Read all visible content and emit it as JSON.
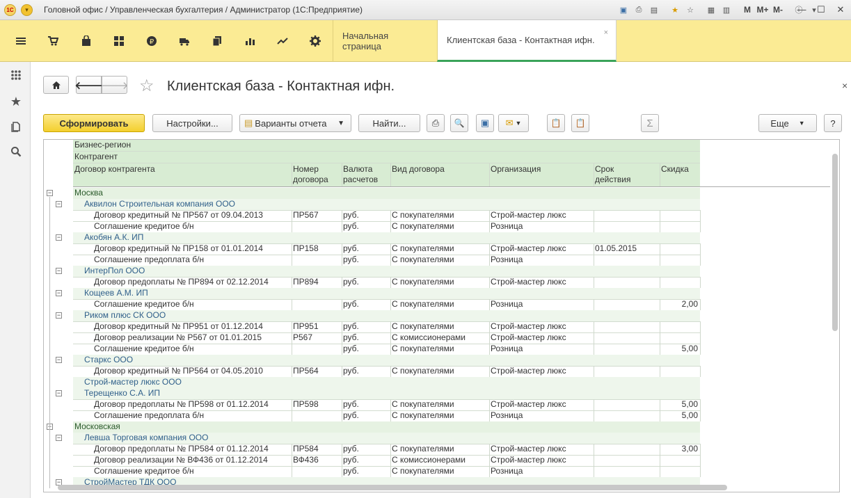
{
  "window": {
    "title": "Головной офис / Управленческая бухгалтерия / Администратор  (1С:Предприятие)",
    "logo": "1С",
    "app_menu_icon": "chevron-down-icon",
    "icons": [
      "save-icon",
      "print-icon",
      "preview-icon",
      "favorite-add-icon",
      "favorite-icon",
      "calculator-icon",
      "calendar-icon"
    ],
    "m_labels": [
      "M",
      "M+",
      "M-"
    ],
    "info_icon": "info-icon"
  },
  "sections": [
    "menu-icon",
    "cart-icon",
    "bag-icon",
    "grid-icon",
    "ruble-icon",
    "truck-icon",
    "documents-icon",
    "bar-chart-icon",
    "trend-icon",
    "gear-icon"
  ],
  "tabs": [
    {
      "label": "Начальная страница"
    },
    {
      "label": "Клиентская база - Контактная ифн.",
      "close": "×"
    }
  ],
  "leftbar": [
    "apps-icon",
    "star-icon",
    "history-icon",
    "search-icon"
  ],
  "page": {
    "title": "Клиентская база - Контактная ифн.",
    "close": "×",
    "star": "☆"
  },
  "buttons": {
    "generate": "Сформировать",
    "settings": "Настройки...",
    "variants": "Варианты отчета",
    "find": "Найти...",
    "more": "Еще",
    "help": "?",
    "sigma": "Σ"
  },
  "report": {
    "header": {
      "level1": "Бизнес-регион",
      "level2": "Контрагент",
      "columns": [
        "Договор контрагента",
        "Номер\nдоговора",
        "Валюта\nрасчетов",
        "Вид договора",
        "Организация",
        "Срок\nдействия",
        "Скидка"
      ]
    },
    "rows": [
      {
        "level": 0,
        "text": "Москва"
      },
      {
        "level": 1,
        "text": "Аквилон Строительная компания ООО"
      },
      {
        "level": 2,
        "cells": [
          "Договор кредитный № ПР567 от 09.04.2013",
          "ПР567",
          "руб.",
          "С покупателями",
          "Строй-мастер люкс",
          "",
          ""
        ]
      },
      {
        "level": 2,
        "cells": [
          "Соглашение кредитое б/н",
          "",
          "руб.",
          "С покупателями",
          "Розница",
          "",
          ""
        ]
      },
      {
        "level": 1,
        "text": "Акобян А.К. ИП"
      },
      {
        "level": 2,
        "cells": [
          "Договор кредитный № ПР158 от 01.01.2014",
          "ПР158",
          "руб.",
          "С покупателями",
          "Строй-мастер люкс",
          "01.05.2015",
          ""
        ]
      },
      {
        "level": 2,
        "cells": [
          "Соглашение предоплата б/н",
          "",
          "руб.",
          "С покупателями",
          "Розница",
          "",
          ""
        ]
      },
      {
        "level": 1,
        "text": "ИнтерПол ООО"
      },
      {
        "level": 2,
        "cells": [
          "Договор предоплаты № ПР894 от 02.12.2014",
          "ПР894",
          "руб.",
          "С покупателями",
          "Строй-мастер люкс",
          "",
          ""
        ]
      },
      {
        "level": 1,
        "text": "Кощеев А.М. ИП"
      },
      {
        "level": 2,
        "cells": [
          "Соглашение кредитое б/н",
          "",
          "руб.",
          "С покупателями",
          "Розница",
          "",
          "2,00"
        ]
      },
      {
        "level": 1,
        "text": "Риком плюс СК ООО"
      },
      {
        "level": 2,
        "cells": [
          "Договор кредитный № ПР951 от 01.12.2014",
          "ПР951",
          "руб.",
          "С покупателями",
          "Строй-мастер люкс",
          "",
          ""
        ]
      },
      {
        "level": 2,
        "cells": [
          "Договор реализации № Р567 от 01.01.2015",
          "Р567",
          "руб.",
          "С комиссионерами",
          "Строй-мастер люкс",
          "",
          ""
        ]
      },
      {
        "level": 2,
        "cells": [
          "Соглашение кредитое б/н",
          "",
          "руб.",
          "С покупателями",
          "Розница",
          "",
          "5,00"
        ]
      },
      {
        "level": 1,
        "text": "Старкс ООО"
      },
      {
        "level": 2,
        "cells": [
          "Договор кредитный № ПР564 от 04.05.2010",
          "ПР564",
          "руб.",
          "С покупателями",
          "Строй-мастер люкс",
          "",
          ""
        ]
      },
      {
        "level": 1,
        "text": "Строй-мастер люкс ООО",
        "noexp": true
      },
      {
        "level": 1,
        "text": "Терещенко С.А. ИП"
      },
      {
        "level": 2,
        "cells": [
          "Договор предоплаты № ПР598 от 01.12.2014",
          "ПР598",
          "руб.",
          "С покупателями",
          "Строй-мастер люкс",
          "",
          "5,00"
        ]
      },
      {
        "level": 2,
        "cells": [
          "Соглашение предоплата б/н",
          "",
          "руб.",
          "С покупателями",
          "Розница",
          "",
          "5,00"
        ]
      },
      {
        "level": 0,
        "text": "Московская"
      },
      {
        "level": 1,
        "text": "Левша Торговая компания ООО"
      },
      {
        "level": 2,
        "cells": [
          "Договор предоплаты № ПР584 от 01.12.2014",
          "ПР584",
          "руб.",
          "С покупателями",
          "Строй-мастер люкс",
          "",
          "3,00"
        ]
      },
      {
        "level": 2,
        "cells": [
          "Договор реализации № ВФ436 от 01.12.2014",
          "ВФ436",
          "руб.",
          "С комиссионерами",
          "Строй-мастер люкс",
          "",
          ""
        ]
      },
      {
        "level": 2,
        "cells": [
          "Соглашение кредитое б/н",
          "",
          "руб.",
          "С покупателями",
          "Розница",
          "",
          ""
        ]
      },
      {
        "level": 1,
        "text": "СтройМастер ТДК ООО"
      }
    ]
  }
}
